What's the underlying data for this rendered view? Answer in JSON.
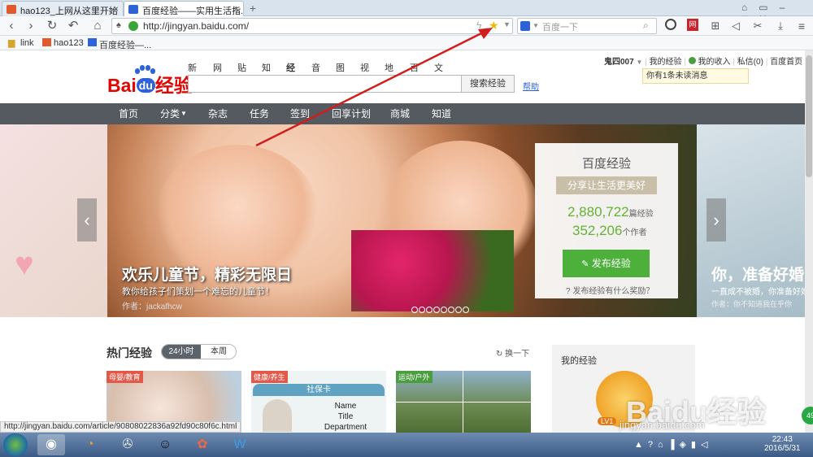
{
  "browser": {
    "tabs": [
      {
        "label": "hao123_上网从这里开始"
      },
      {
        "label": "百度经验——实用生活指..."
      }
    ],
    "url": "http://jingyan.baidu.com/",
    "search_placeholder": "百度一下",
    "bookmarks": [
      "link",
      "hao123",
      "百度经验—..."
    ],
    "status_url": "http://jingyan.baidu.com/article/90808022836a92fd90c80f6c.html"
  },
  "site": {
    "logo_text": "Bai",
    "logo_du": "du",
    "logo_suffix": "经验",
    "top_links": [
      "新闻",
      "网页",
      "贴吧",
      "知道",
      "经验",
      "音乐",
      "图片",
      "视频",
      "地图",
      "百科",
      "文库"
    ],
    "search_button": "搜索经验",
    "help": "帮助",
    "user": {
      "name": "鬼四007",
      "links": [
        "我的经验",
        "我的收入",
        "私信(0)",
        "百度首页"
      ],
      "notice": "你有1条未读消息"
    },
    "main_nav": [
      "首页",
      "分类",
      "杂志",
      "任务",
      "签到",
      "回享计划",
      "商城",
      "知道"
    ]
  },
  "banner": {
    "title": "欢乐儿童节，精彩无限日",
    "subtitle": "教你给孩子们策划一个难忘的儿童节！",
    "author": "作者：jackafhcw",
    "right_title": "你，准备好婚",
    "right_sub": "一直成不被婚，你准备好婚时",
    "right_author": "作者：你不知道我在乎你"
  },
  "stats_card": {
    "title": "百度经验",
    "ribbon": "分享让生活更美好",
    "count1": "2,880,722",
    "count1_unit": "篇经验",
    "count2": "352,206",
    "count2_unit": "个作者",
    "publish_button": "发布经验",
    "reward_link": "发布经验有什么奖励？"
  },
  "hot": {
    "title": "热门经验",
    "tabs": [
      "24小时",
      "本周"
    ],
    "refresh": "换一下",
    "cards": [
      {
        "tag": "母婴/教育"
      },
      {
        "tag": "健康/养生",
        "card_title": "社保卡",
        "fields": [
          "Name",
          "Title",
          "Department"
        ]
      },
      {
        "tag": "运动/户外"
      }
    ]
  },
  "my_exp": {
    "title": "我的经验",
    "level": "LV1"
  },
  "watermark": {
    "brand": "Baidu经验",
    "url": "jingyan.baidu.com"
  },
  "taskbar": {
    "time": "22:43",
    "date": "2016/5/31",
    "badge": "49"
  }
}
